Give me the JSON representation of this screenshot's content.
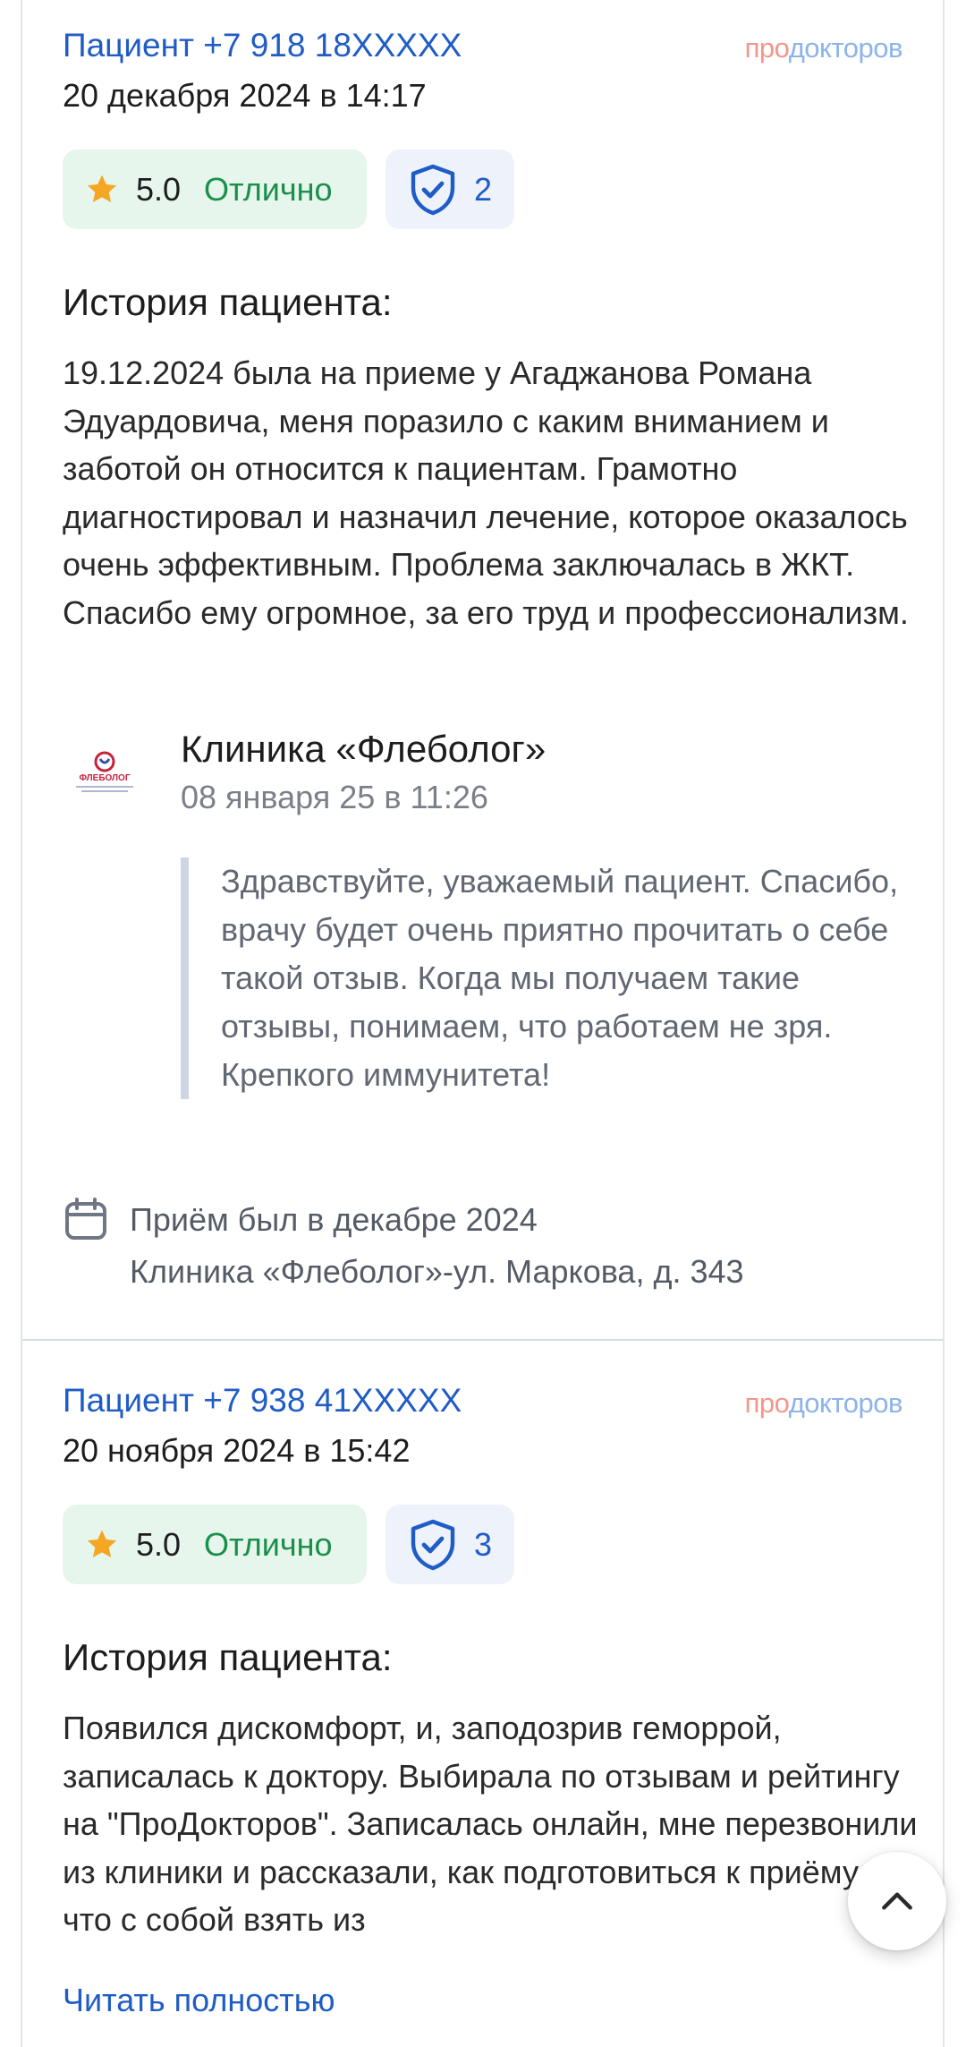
{
  "brand": {
    "pro": "про",
    "rest": "докторов"
  },
  "reviews": [
    {
      "author": "Пациент +7 918 18XXXXX",
      "date": "20 декабря 2024 в 14:17",
      "rating_score": "5.0",
      "rating_label": "Отлично",
      "verified_count": "2",
      "story_title": "История пациента:",
      "story_text": "19.12.2024 была на приеме у Агаджанова Романа Эдуардовича, меня поразило с каким вниманием и заботой он относится к пациентам. Грамотно диагностировал и назначил лечение, которое оказалось очень эффективным. Проблема заключалась в ЖКТ. Спасибо ему огромное, за его труд и профессионализм.",
      "clinic_name": "Клиника «Флеболог»",
      "clinic_logo_text": "ФЛЕБОЛОГ",
      "reply_date": "08 января 25 в 11:26",
      "reply_text": "Здравствуйте, уважаемый пациент. Спасибо, врачу будет очень приятно прочитать о себе такой отзыв. Когда мы получаем такие отзывы, понимаем, что работаем не зря. Крепкого иммунитета!",
      "visit_when": "Приём был в декабре 2024",
      "visit_where": "Клиника «Флеболог»-ул. Маркова, д. 343"
    },
    {
      "author": "Пациент +7 938 41XXXXX",
      "date": "20 ноября 2024 в 15:42",
      "rating_score": "5.0",
      "rating_label": "Отлично",
      "verified_count": "3",
      "story_title": "История пациента:",
      "story_text": "Появился дискомфорт, и, заподозрив геморрой, записалась к доктору. Выбирала по отзывам и рейтингу на \"ПроДокторов\". Записалась онлайн, мне перезвонили из клиники и рассказали, как подготовиться к приёму, что с собой взять из",
      "read_more": "Читать полностью"
    }
  ],
  "colors": {
    "link": "#1f5cc5",
    "rating_bg": "#e6f6ec",
    "rating_text": "#1a8f4a",
    "star": "#f5a623",
    "quote_bar": "#cdd6e2"
  },
  "icons": {
    "star": "star-icon",
    "verified": "shield-check-icon",
    "calendar": "calendar-icon",
    "scroll_top": "chevron-up-icon"
  }
}
